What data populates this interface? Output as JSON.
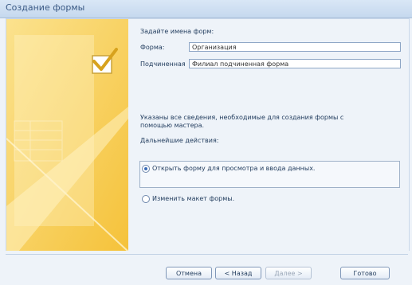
{
  "window": {
    "title": "Создание формы"
  },
  "content": {
    "prompt": "Задайте имена форм:",
    "form_label": "Форма:",
    "form_value": "Организация",
    "subform_label": "Подчиненная",
    "subform_value": "Филиал подчиненная форма",
    "info_line1": "Указаны все сведения, необходимые для создания формы с",
    "info_line2": "помощью мастера.",
    "next_actions": "Дальнейшие действия:"
  },
  "options": [
    {
      "label": "Открыть форму для просмотра и ввода данных.",
      "selected": true
    },
    {
      "label": "Изменить макет формы.",
      "selected": false
    }
  ],
  "buttons": {
    "cancel": "Отмена",
    "back": "< Назад",
    "next": "Далее >",
    "finish": "Готово"
  },
  "colors": {
    "accent": "#f6c445",
    "art_light": "#fde9a8",
    "title_text": "#3b5a85"
  }
}
